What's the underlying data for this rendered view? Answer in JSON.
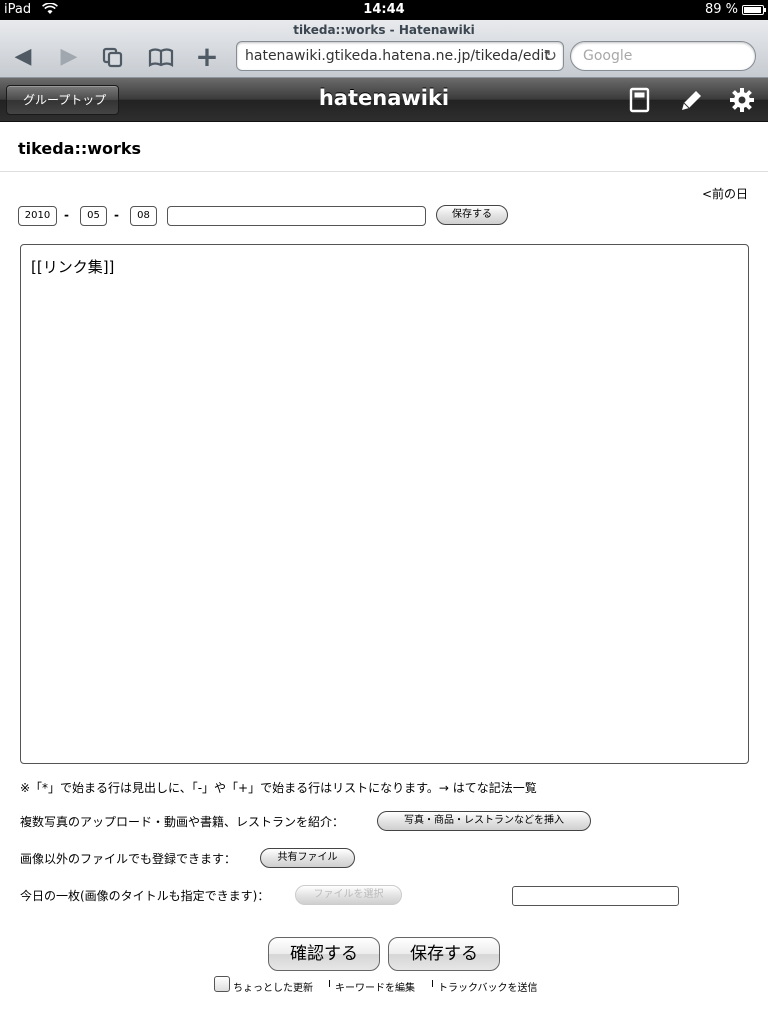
{
  "status_bar": {
    "device": "iPad",
    "time": "14:44",
    "battery": "89 %"
  },
  "browser": {
    "page_title": "tikeda::works - Hatenawiki",
    "url": "hatenawiki.gtikeda.hatena.ne.jp/tikeda/edit",
    "search_placeholder": "Google"
  },
  "header": {
    "back_label": "グループトップ",
    "title": "hatenawiki"
  },
  "page": {
    "wiki_title": "tikeda::works",
    "prev_day": "<前の日",
    "date": {
      "year": "2010",
      "month": "05",
      "day": "08",
      "separator": "-"
    },
    "entry_title_value": "",
    "save_small": "保存する",
    "body_text": "[[リンク集]]",
    "notation_note": "※「*」で始まる行は見出しに、「-」や「+」で始まる行はリストになります。→ はてな記法一覧",
    "photo_label": "複数写真のアップロード・動画や書籍、レストランを紹介：",
    "photo_button": "写真・商品・レストランなどを挿入",
    "shared_label": "画像以外のファイルでも登録できます：",
    "shared_button": "共有ファイル",
    "today_label": "今日の一枚(画像のタイトルも指定できます)：",
    "file_button": "ファイルを選択",
    "confirm_button": "確認する",
    "save_button": "保存する",
    "minor_update": "ちょっとした更新",
    "edit_keyword": "キーワードを編集",
    "send_trackback": "トラックバックを送信",
    "link_separator": "I"
  }
}
